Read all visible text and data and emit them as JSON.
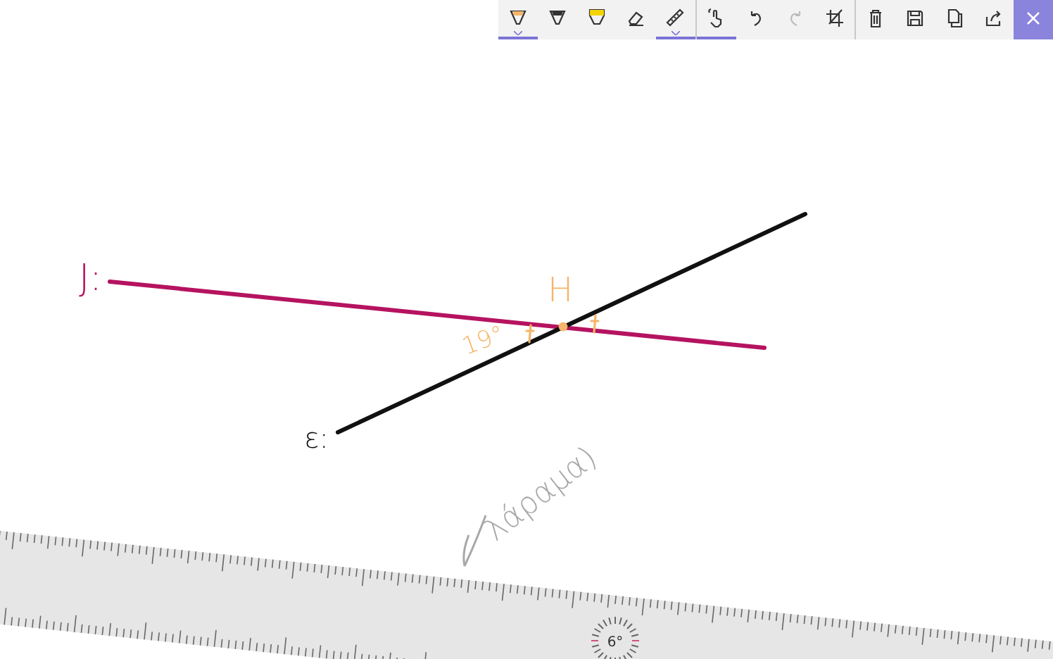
{
  "toolbar": {
    "groups": [
      {
        "buttons": [
          {
            "kind": "ballpoint-pen",
            "selected": true
          },
          {
            "kind": "pencil",
            "selected": false
          },
          {
            "kind": "highlighter",
            "selected": false
          },
          {
            "kind": "eraser",
            "selected": false
          },
          {
            "kind": "ruler",
            "selected": true
          }
        ]
      },
      {
        "buttons": [
          {
            "kind": "touch-writing",
            "selected": true
          },
          {
            "kind": "undo",
            "disabled": false
          },
          {
            "kind": "redo",
            "disabled": true
          },
          {
            "kind": "crop",
            "disabled": false
          }
        ]
      },
      {
        "buttons": [
          {
            "kind": "delete"
          },
          {
            "kind": "save"
          },
          {
            "kind": "copy"
          },
          {
            "kind": "share"
          }
        ]
      }
    ]
  },
  "canvas": {
    "labels": [
      {
        "text": "J:",
        "color": "#b5135f"
      },
      {
        "text": "ε:",
        "color": "#111111"
      },
      {
        "text": "H",
        "color": "#f5b56a"
      },
      {
        "text": "19°",
        "color": "#f5b56a"
      },
      {
        "text": "λάραμα)",
        "color": "#a8a8a8"
      }
    ]
  },
  "ruler": {
    "angle_reading": "6°"
  }
}
